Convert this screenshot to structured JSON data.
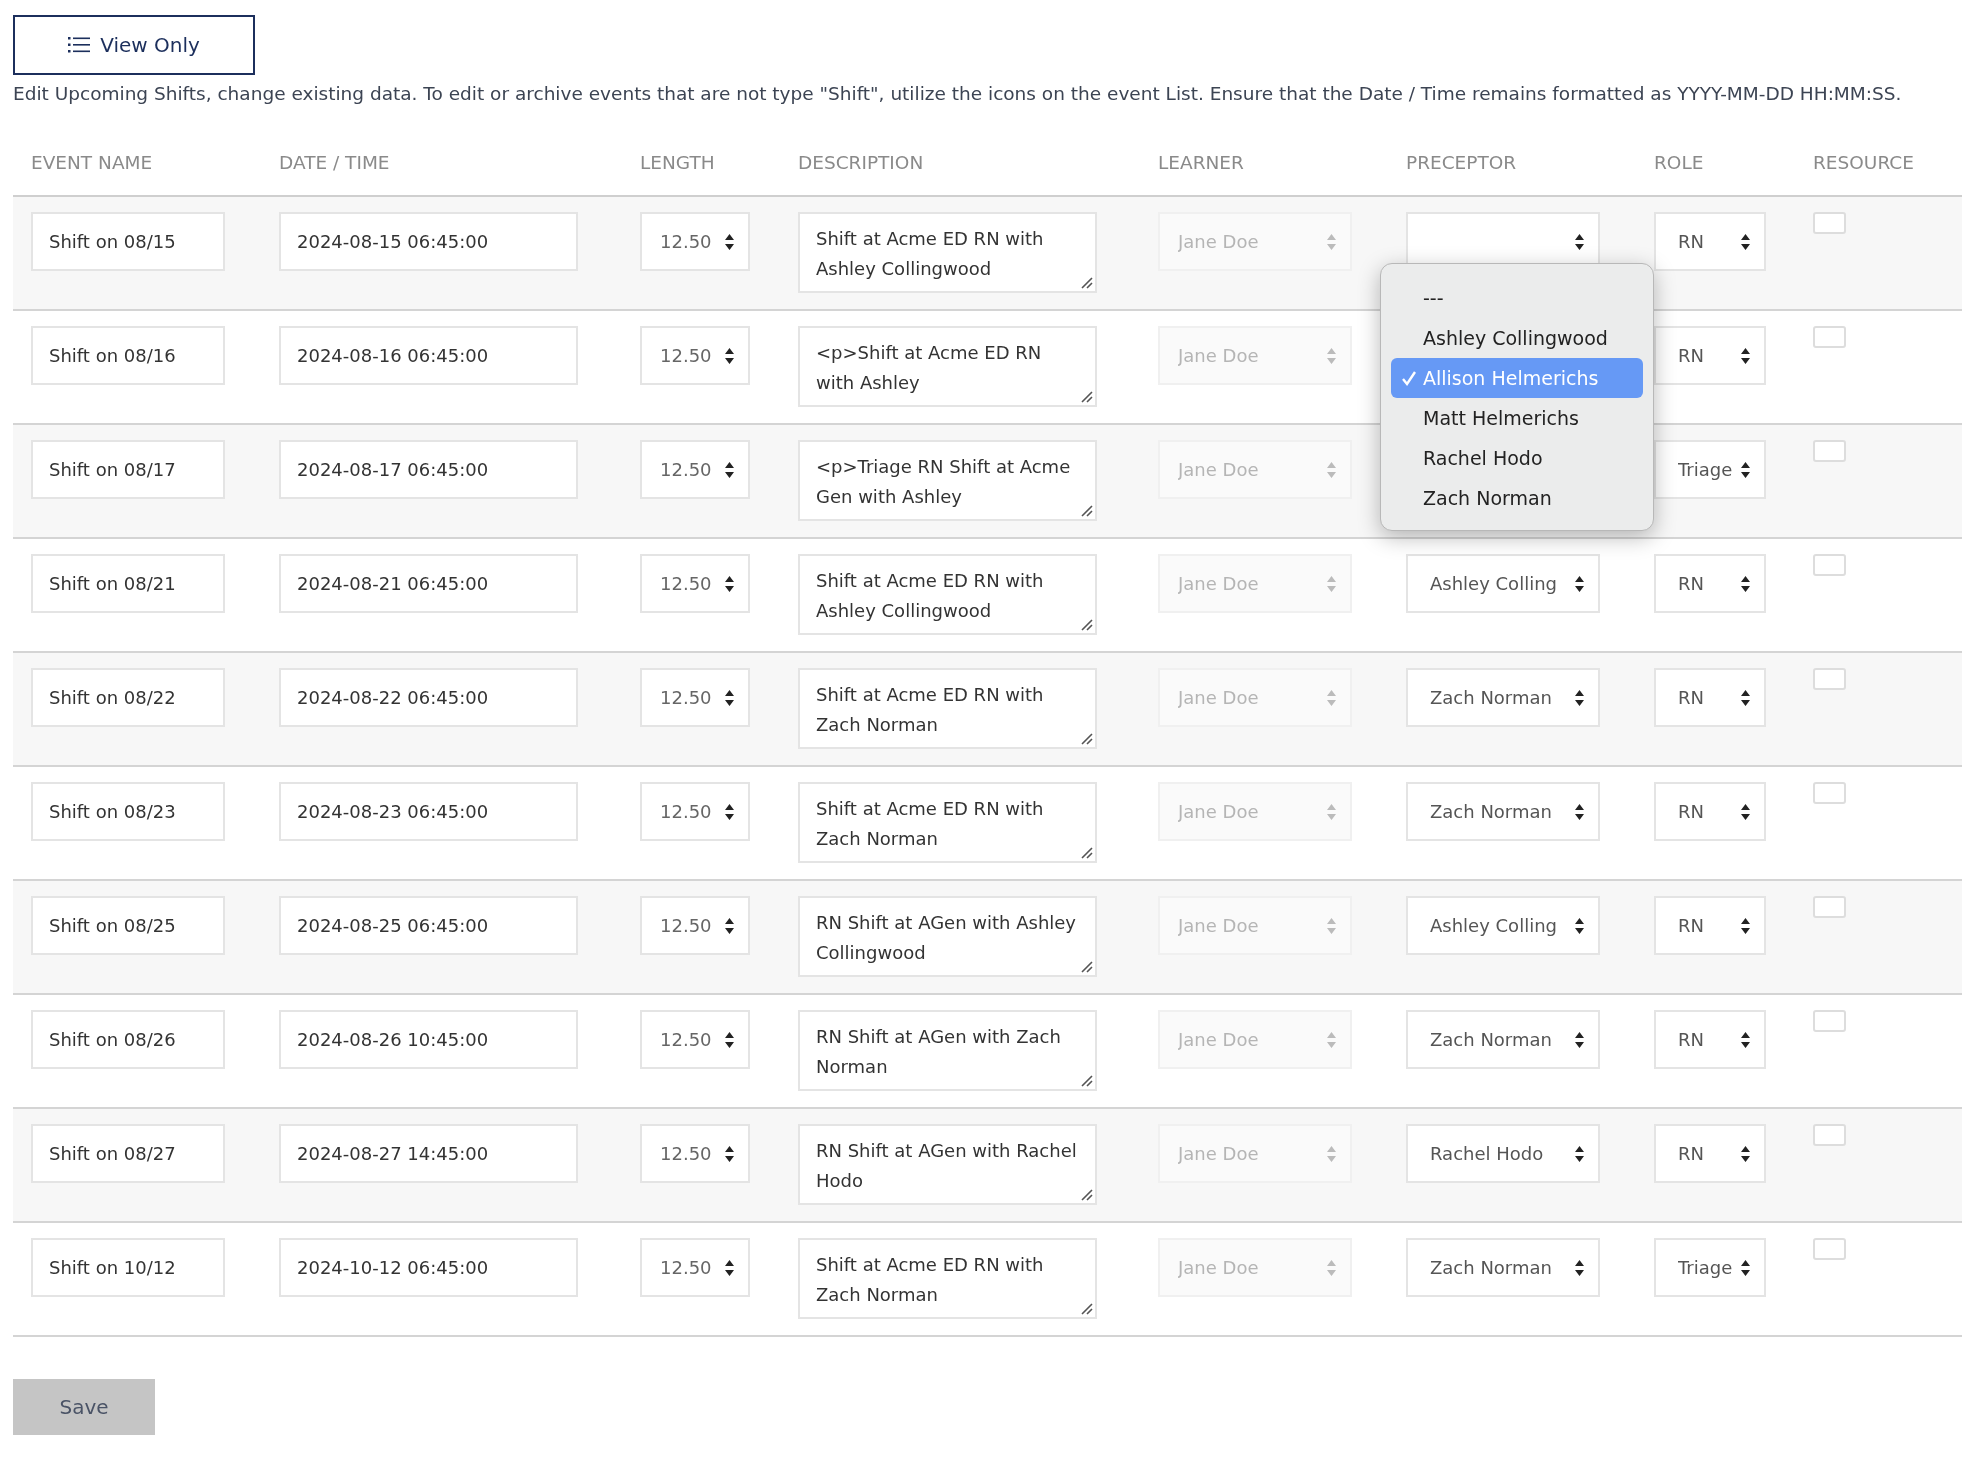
{
  "view_button": {
    "label": "View Only"
  },
  "instructions": "Edit Upcoming Shifts, change existing data. To edit or archive events that are not type \"Shift\", utilize the icons on the event List. Ensure that the Date / Time remains formatted as YYYY-MM-DD HH:MM:SS.",
  "columns": [
    "EVENT NAME",
    "DATE / TIME",
    "LENGTH",
    "DESCRIPTION",
    "LEARNER",
    "PRECEPTOR",
    "ROLE",
    "RESOURCE"
  ],
  "rows": [
    {
      "event_name": "Shift on 08/15",
      "date_time": "2024-08-15 06:45:00",
      "length": "12.50",
      "description": "Shift at Acme ED RN with Ashley Collingwood",
      "learner": {
        "value": "Jane Doe",
        "disabled": true
      },
      "preceptor_open": true,
      "role": "RN",
      "resource": false
    },
    {
      "event_name": "Shift on 08/16",
      "date_time": "2024-08-16 06:45:00",
      "length": "12.50",
      "description": "<p>Shift at Acme ED RN with Ashley",
      "learner": {
        "value": "Jane Doe",
        "disabled": true
      },
      "role": "RN",
      "resource": false
    },
    {
      "event_name": "Shift on 08/17",
      "date_time": "2024-08-17 06:45:00",
      "length": "12.50",
      "description": "<p>Triage RN Shift at Acme Gen with Ashley",
      "learner": {
        "value": "Jane Doe",
        "disabled": true
      },
      "role": "Triage",
      "resource": false
    },
    {
      "event_name": "Shift on 08/21",
      "date_time": "2024-08-21 06:45:00",
      "length": "12.50",
      "description": "Shift at Acme ED RN with Ashley Collingwood",
      "learner": {
        "value": "Jane Doe",
        "disabled": true
      },
      "preceptor": "Ashley Colling",
      "role": "RN",
      "resource": false
    },
    {
      "event_name": "Shift on 08/22",
      "date_time": "2024-08-22 06:45:00",
      "length": "12.50",
      "description": "Shift at Acme ED RN with Zach Norman",
      "learner": {
        "value": "Jane Doe",
        "disabled": true
      },
      "preceptor": "Zach Norman",
      "role": "RN",
      "resource": false
    },
    {
      "event_name": "Shift on 08/23",
      "date_time": "2024-08-23 06:45:00",
      "length": "12.50",
      "description": "Shift at Acme ED RN with Zach Norman",
      "learner": {
        "value": "Jane Doe",
        "disabled": true
      },
      "preceptor": "Zach Norman",
      "role": "RN",
      "resource": false
    },
    {
      "event_name": "Shift on 08/25",
      "date_time": "2024-08-25 06:45:00",
      "length": "12.50",
      "description": "RN Shift at AGen with Ashley Collingwood",
      "learner": {
        "value": "Jane Doe",
        "disabled": true
      },
      "preceptor": "Ashley Colling",
      "role": "RN",
      "resource": false
    },
    {
      "event_name": "Shift on 08/26",
      "date_time": "2024-08-26 10:45:00",
      "length": "12.50",
      "description": "RN Shift at AGen with Zach Norman",
      "learner": {
        "value": "Jane Doe",
        "disabled": true
      },
      "preceptor": "Zach Norman",
      "role": "RN",
      "resource": false
    },
    {
      "event_name": "Shift on 08/27",
      "date_time": "2024-08-27 14:45:00",
      "length": "12.50",
      "description": "RN Shift at AGen with Rachel Hodo",
      "learner": {
        "value": "Jane Doe",
        "disabled": true
      },
      "preceptor": "Rachel Hodo",
      "role": "RN",
      "resource": false
    },
    {
      "event_name": "Shift on 10/12",
      "date_time": "2024-10-12 06:45:00",
      "length": "12.50",
      "description": "Shift at Acme ED RN with Zach Norman",
      "learner": {
        "value": "Jane Doe",
        "disabled": true
      },
      "preceptor": "Zach Norman",
      "role": "Triage",
      "resource": false
    }
  ],
  "preceptor_menu": {
    "options": [
      {
        "label": "---",
        "selected": false
      },
      {
        "label": "Ashley Collingwood",
        "selected": false
      },
      {
        "label": "Allison Helmerichs",
        "selected": true
      },
      {
        "label": "Matt Helmerichs",
        "selected": false
      },
      {
        "label": "Rachel Hodo",
        "selected": false
      },
      {
        "label": "Zach Norman",
        "selected": false
      }
    ]
  },
  "save_button": {
    "label": "Save"
  }
}
